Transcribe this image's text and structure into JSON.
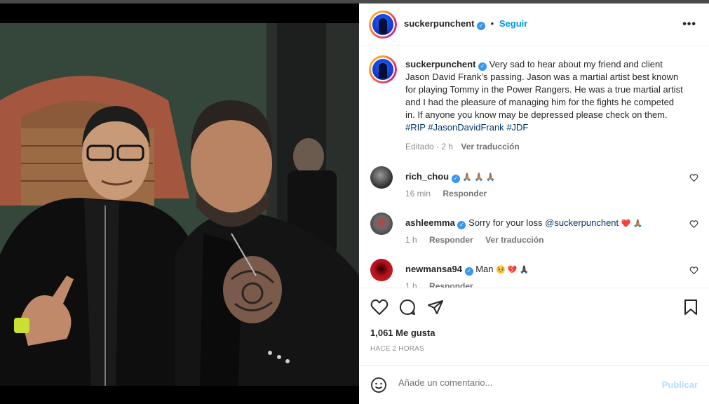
{
  "post": {
    "author": "suckerpunchent",
    "follow_label": "Seguir",
    "separator": "•",
    "more_label": "•••"
  },
  "caption": {
    "username": "suckerpunchent",
    "text": "Very sad to hear about my friend and client Jason David Frank’s passing. Jason was a martial artist best known for playing Tommy in the Power Rangers. He was a true martial artist and I had the pleasure of managing him for the fights he competed in. If anyone you know may be depressed please check on them.",
    "hashtags": [
      "#RIP",
      "#JasonDavidFrank",
      "#JDF"
    ],
    "edited": "Editado · 2 h",
    "translate": "Ver traducción"
  },
  "comments": [
    {
      "username": "rich_chou",
      "text": "",
      "emojis": "🙏🏽 🙏🏽 🙏🏽",
      "time": "16 min",
      "reply": "Responder",
      "translate": ""
    },
    {
      "username": "ashleemma",
      "text": "Sorry for your loss ",
      "mention": "@suckerpunchent",
      "emojis": "❤️ 🙏🏽",
      "time": "1 h",
      "reply": "Responder",
      "translate": "Ver traducción"
    },
    {
      "username": "newmansa94",
      "text": "Man ",
      "emojis": "🥺 💔 🙏🏿",
      "time": "1 h",
      "reply": "Responder",
      "translate": ""
    }
  ],
  "stats": {
    "likes": "1,061 Me gusta",
    "posted": "HACE 2 HORAS"
  },
  "composer": {
    "placeholder": "Añade un comentario...",
    "publish": "Publicar"
  },
  "icons": {
    "more": "more-icon",
    "like": "heart-icon",
    "comment": "comment-icon",
    "share": "send-icon",
    "save": "bookmark-icon",
    "emoji": "emoji-icon"
  },
  "colors": {
    "link": "#0095f6",
    "hashtag": "#00376b",
    "verified": "#3797f0",
    "publish_disabled": "#b2dffc"
  }
}
